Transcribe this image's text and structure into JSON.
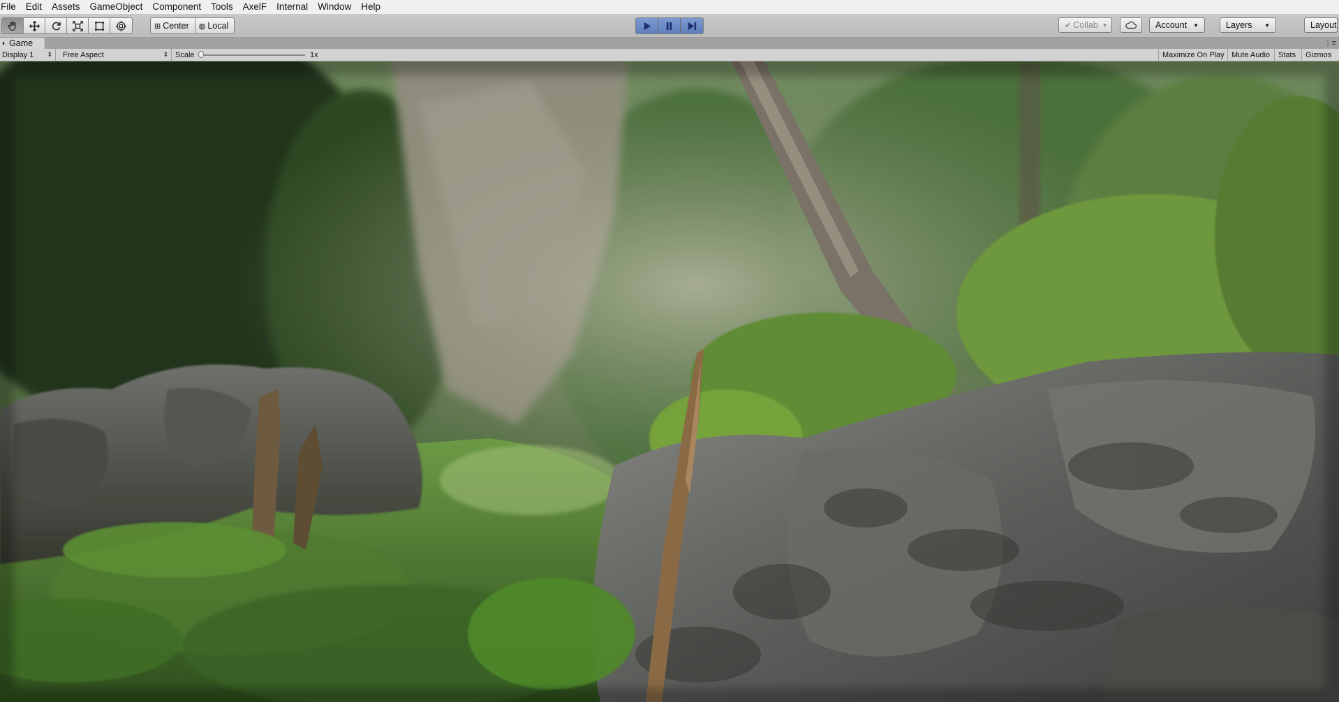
{
  "menu": [
    "File",
    "Edit",
    "Assets",
    "GameObject",
    "Component",
    "Tools",
    "AxelF",
    "Internal",
    "Window",
    "Help"
  ],
  "toolbar": {
    "transform_tools": [
      {
        "name": "hand-tool",
        "icon": "hand-icon",
        "active": true
      },
      {
        "name": "move-tool",
        "icon": "move-icon",
        "active": false
      },
      {
        "name": "rotate-tool",
        "icon": "rotate-icon",
        "active": false
      },
      {
        "name": "scale-tool",
        "icon": "scale-icon",
        "active": false
      },
      {
        "name": "rect-tool",
        "icon": "rect-icon",
        "active": false
      },
      {
        "name": "transform-tool",
        "icon": "transform-icon",
        "active": false
      }
    ],
    "pivot_label": "Center",
    "space_label": "Local",
    "collab_label": "Collab",
    "account_label": "Account",
    "layers_label": "Layers",
    "layout_label": "Layout",
    "play_state": {
      "playing": true,
      "paused": false
    },
    "accent_color": "#5f7fbc"
  },
  "game_tab": {
    "title": "Game"
  },
  "game_toolbar": {
    "display": "Display 1",
    "aspect": "Free Aspect",
    "scale_label": "Scale",
    "scale_value": "1x",
    "maximize_on_play": "Maximize On Play",
    "mute_audio": "Mute Audio",
    "stats": "Stats",
    "gizmos": "Gizmos"
  },
  "viewport": {
    "scene_description_icon": "forest-scene"
  }
}
